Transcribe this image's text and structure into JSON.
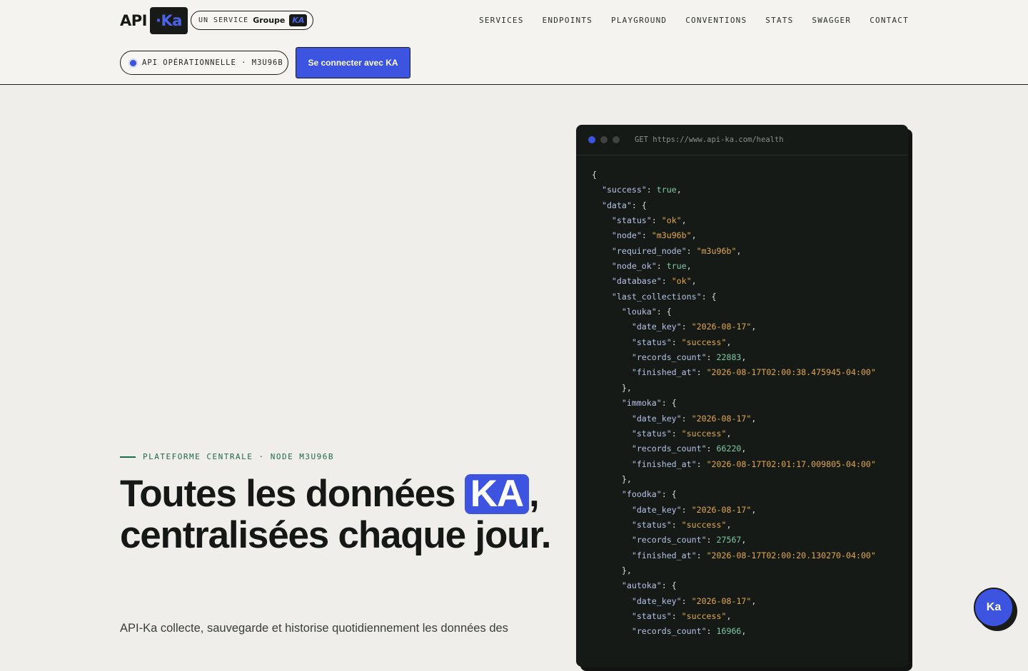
{
  "header": {
    "logo_prefix": "API",
    "logo_suffix": "·Ka",
    "service_label": "UN SERVICE",
    "service_brand": "Groupe",
    "service_brand_badge": "KA",
    "nav": [
      {
        "label": "SERVICES"
      },
      {
        "label": "ENDPOINTS"
      },
      {
        "label": "PLAYGROUND"
      },
      {
        "label": "CONVENTIONS"
      },
      {
        "label": "STATS"
      },
      {
        "label": "SWAGGER"
      },
      {
        "label": "CONTACT"
      }
    ],
    "status_text": "API OPÉRATIONNELLE · M3U96B",
    "connect_button": "Se connecter avec KA"
  },
  "hero": {
    "eyebrow": "PLATEFORME CENTRALE · NODE M3U96B",
    "title_part1": "Toutes les données ",
    "title_highlight": "KA",
    "title_part2": ", centralisées chaque jour.",
    "description": "API-Ka collecte, sauvegarde et historise quotidiennement les données des"
  },
  "code_panel": {
    "request": "GET https://www.api-ka.com/health",
    "response": {
      "success": "true",
      "status": "\"ok\"",
      "node": "\"m3u96b\"",
      "required_node": "\"m3u96b\"",
      "node_ok": "true",
      "database": "\"ok\"",
      "collections": [
        {
          "name": "louka",
          "date_key": "\"2026-08-17\"",
          "status": "\"success\"",
          "records_count": "22883",
          "finished_at": "\"2026-08-17T02:00:38.475945-04:00\""
        },
        {
          "name": "immoka",
          "date_key": "\"2026-08-17\"",
          "status": "\"success\"",
          "records_count": "66220",
          "finished_at": "\"2026-08-17T02:01:17.009805-04:00\""
        },
        {
          "name": "foodka",
          "date_key": "\"2026-08-17\"",
          "status": "\"success\"",
          "records_count": "27567",
          "finished_at": "\"2026-08-17T02:00:20.130270-04:00\""
        },
        {
          "name": "autoka",
          "date_key": "\"2026-08-17\"",
          "status": "\"success\"",
          "records_count": "16966"
        }
      ]
    }
  },
  "floating_button": "Ka",
  "colors": {
    "accent": "#3c54e0",
    "dark": "#161a17",
    "background": "#efeeeb",
    "eyebrow_green": "#1f6a46",
    "json_string": "#e3a84c",
    "json_number": "#7fc9a0"
  }
}
